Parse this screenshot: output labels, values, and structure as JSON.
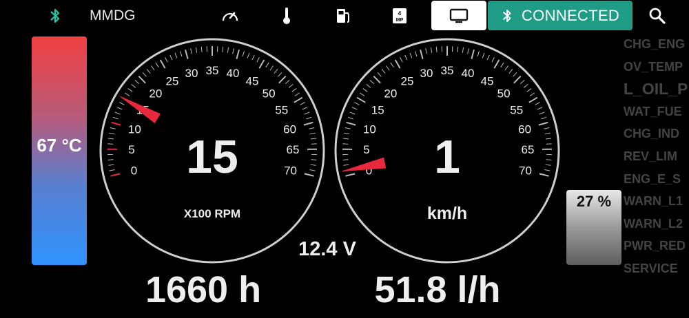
{
  "header": {
    "app_name": "MMDG",
    "connection_label": "CONNECTED",
    "icons": [
      "bluetooth-icon",
      "speedometer-icon",
      "thermometer-icon",
      "fuel-pump-icon",
      "gear-shift-icon",
      "monitor-icon",
      "bluetooth-icon",
      "search-icon"
    ]
  },
  "temperature": {
    "label": "67 °C"
  },
  "fuel_level": {
    "label": "27 %",
    "fraction": 0.27
  },
  "rpm_gauge": {
    "value": "15",
    "unit": "X100  RPM",
    "ticks": [
      "0",
      "5",
      "10",
      "15",
      "20",
      "25",
      "30",
      "35",
      "40",
      "45",
      "50",
      "55",
      "60",
      "65",
      "70"
    ],
    "needle_value": 15
  },
  "speed_gauge": {
    "value": "1",
    "unit": "km/h",
    "ticks": [
      "0",
      "5",
      "10",
      "15",
      "20",
      "25",
      "30",
      "35",
      "40",
      "45",
      "50",
      "55",
      "60",
      "65",
      "70"
    ],
    "needle_value": 1
  },
  "voltage": "12.4 V",
  "engine_hours": "1660 h",
  "fuel_rate": "51.8 l/h",
  "warnings": [
    "CHG_ENG",
    "OV_TEMP",
    "L_OIL_P",
    "WAT_FUE",
    "CHG_IND",
    "REV_LIM",
    "ENG_E_S",
    "WARN_L1",
    "WARN_L2",
    "PWR_RED",
    "SERVICE"
  ],
  "colors": {
    "accent": "#1e9c86",
    "needle": "#e8283c",
    "temp_hot": "#f04040",
    "temp_cold": "#2f93ff"
  }
}
